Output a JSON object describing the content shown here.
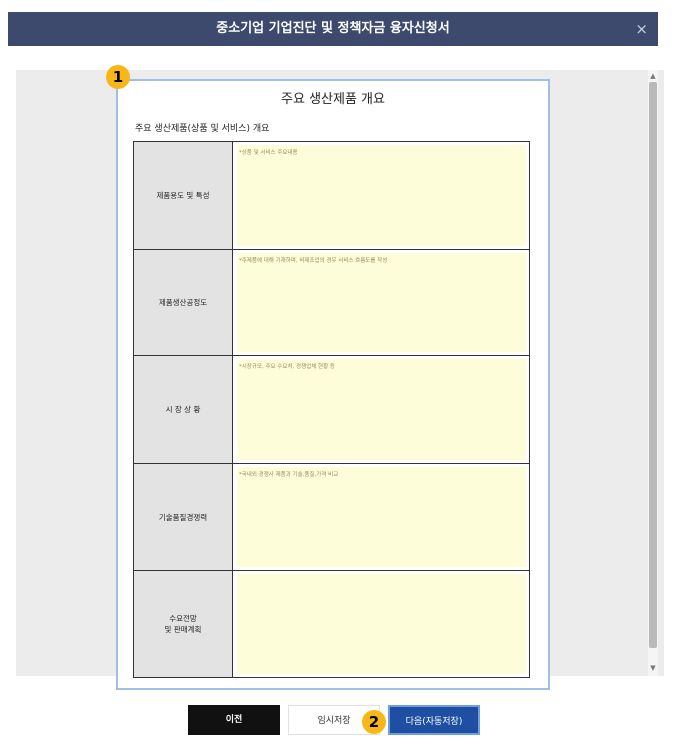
{
  "window": {
    "title": "중소기업 기업진단 및 정책자금 융자신청서",
    "close": "×"
  },
  "markers": {
    "m1": "1",
    "m2": "2"
  },
  "document": {
    "title": "주요 생산제품 개요",
    "section_label": "주요 생산제품(상품 및 서비스) 개요",
    "rows": [
      {
        "label": "제품용도 및 특성",
        "placeholder": "*상품 및 서비스 주요내용"
      },
      {
        "label": "제품생산공정도",
        "placeholder": "*주제품에 대해 기재하며, 비제조업의 경우 서비스 흐름도를 작성"
      },
      {
        "label": "시 장 상 황",
        "placeholder": "*시장규모, 주요 수요처, 경쟁업체 현황 등"
      },
      {
        "label": "기술품질경쟁력",
        "placeholder": "*국내외 경쟁사 제품과 기술,품질,가격 비교"
      },
      {
        "label": "수요전망\n및 판매계획",
        "placeholder": ""
      }
    ]
  },
  "scrollbar": {
    "up": "▲",
    "down": "▼"
  },
  "buttons": {
    "prev": "이전",
    "save": "임시저장",
    "next": "다음(자동저장)"
  }
}
